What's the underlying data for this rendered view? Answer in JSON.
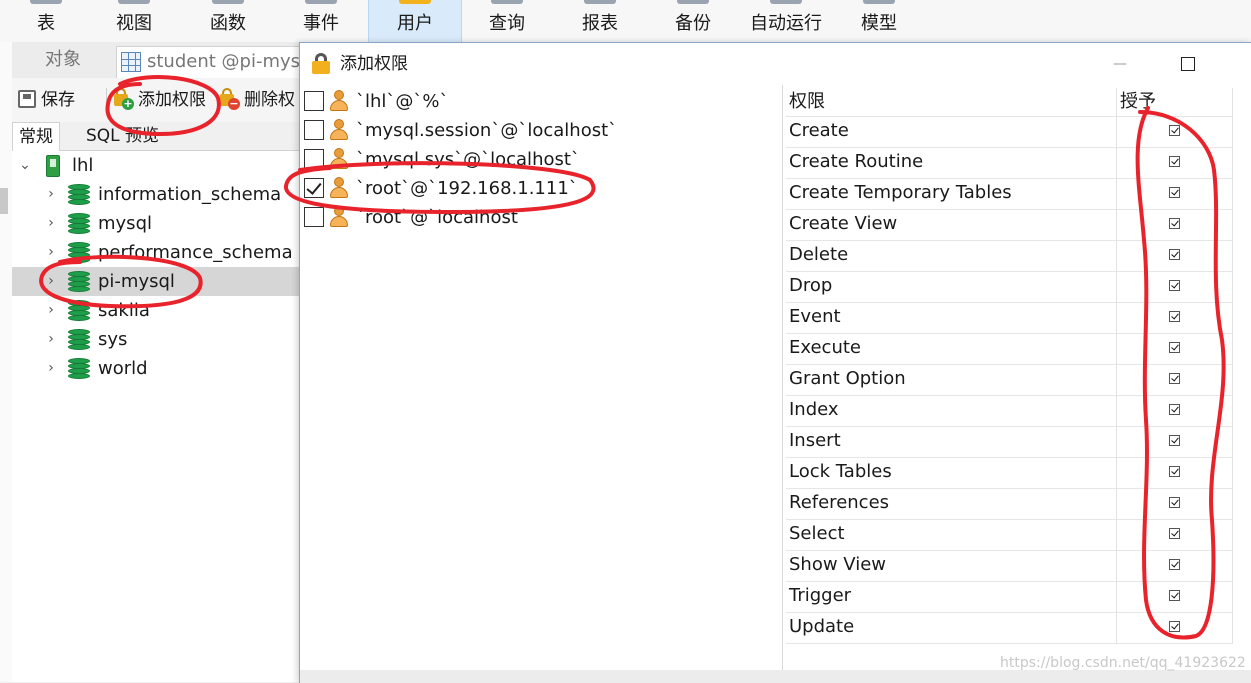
{
  "ribbon": {
    "items": [
      {
        "label": "表"
      },
      {
        "label": "视图"
      },
      {
        "label": "函数"
      },
      {
        "label": "事件"
      },
      {
        "label": "用户"
      },
      {
        "label": "查询"
      },
      {
        "label": "报表"
      },
      {
        "label": "备份"
      },
      {
        "label": "自动运行"
      },
      {
        "label": "模型"
      }
    ],
    "active_index": 4,
    "active_color": "#d9ebfb"
  },
  "tabs": {
    "objects_label": "对象",
    "student_label": "student @pi-mysql"
  },
  "toolbar": {
    "save_label": "保存",
    "add_privilege_label": "添加权限",
    "delete_privilege_label": "删除权"
  },
  "subtabs": {
    "general_label": "常规",
    "sql_preview_label": "SQL 预览"
  },
  "tree": {
    "root": "lhl",
    "databases": [
      {
        "name": "information_schema",
        "selected": false
      },
      {
        "name": "mysql",
        "selected": false
      },
      {
        "name": "performance_schema",
        "selected": false
      },
      {
        "name": "pi-mysql",
        "selected": true
      },
      {
        "name": "sakila",
        "selected": false
      },
      {
        "name": "sys",
        "selected": false
      },
      {
        "name": "world",
        "selected": false
      }
    ]
  },
  "dialog": {
    "title": "添加权限",
    "users": [
      {
        "label": "`lhl`@`%`",
        "checked": false
      },
      {
        "label": "`mysql.session`@`localhost`",
        "checked": false
      },
      {
        "label": "`mysql.sys`@`localhost`",
        "checked": false
      },
      {
        "label": "`root`@`192.168.1.111`",
        "checked": true
      },
      {
        "label": "`root`@`localhost`",
        "checked": false
      }
    ],
    "privilege_header": "权限",
    "grant_header": "授予",
    "privileges": [
      {
        "name": "Create",
        "granted": true
      },
      {
        "name": "Create Routine",
        "granted": true
      },
      {
        "name": "Create Temporary Tables",
        "granted": true
      },
      {
        "name": "Create View",
        "granted": true
      },
      {
        "name": "Delete",
        "granted": true
      },
      {
        "name": "Drop",
        "granted": true
      },
      {
        "name": "Event",
        "granted": true
      },
      {
        "name": "Execute",
        "granted": true
      },
      {
        "name": "Grant Option",
        "granted": true
      },
      {
        "name": "Index",
        "granted": true
      },
      {
        "name": "Insert",
        "granted": true
      },
      {
        "name": "Lock Tables",
        "granted": true
      },
      {
        "name": "References",
        "granted": true
      },
      {
        "name": "Select",
        "granted": true
      },
      {
        "name": "Show View",
        "granted": true
      },
      {
        "name": "Trigger",
        "granted": true
      },
      {
        "name": "Update",
        "granted": true
      }
    ]
  },
  "watermark": "https://blog.csdn.net/qq_41923622",
  "colors": {
    "annotation_red": "#e8232b",
    "db_green": "#1f9e4a",
    "lock_gold": "#f2b01e"
  }
}
